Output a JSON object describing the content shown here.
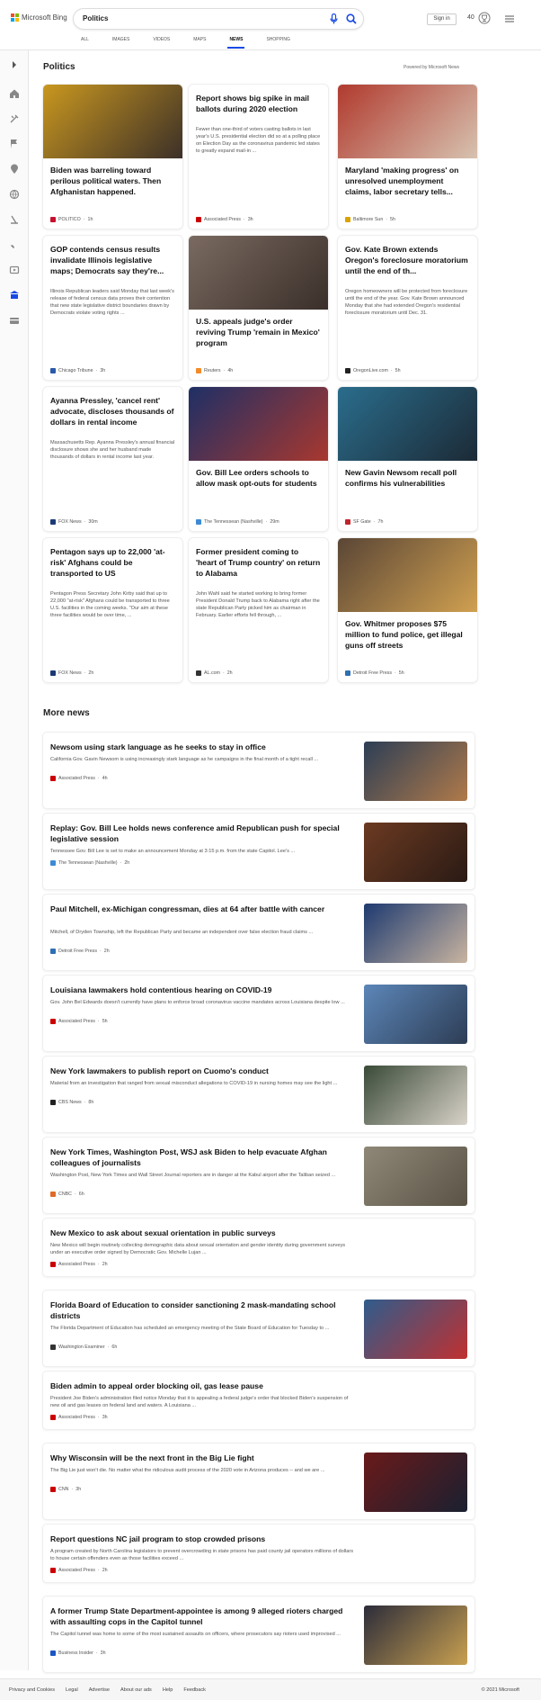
{
  "brand": {
    "logo_text": "Microsoft Bing"
  },
  "search": {
    "query": "Politics"
  },
  "header": {
    "signin_label": "Sign in",
    "rewards_points": "40"
  },
  "tabs": [
    {
      "label": "ALL"
    },
    {
      "label": "IMAGES"
    },
    {
      "label": "VIDEOS"
    },
    {
      "label": "MAPS"
    },
    {
      "label": "NEWS"
    },
    {
      "label": "SHOPPING"
    }
  ],
  "top": {
    "heading": "Politics",
    "powered": "Powered by Microsoft News"
  },
  "cards": [
    {
      "title": "Biden was barreling toward perilous political waters. Then Afghanistan happened.",
      "desc": "",
      "source": "POLITICO",
      "age": "1h",
      "src_color": "#c8102e",
      "img_colors": [
        "#c9971f",
        "#3c3028"
      ]
    },
    {
      "title": "Report shows big spike in mail ballots during 2020 election",
      "desc": "Fewer than one-third of voters casting ballots in last year's U.S. presidential election did so at a polling place on Election Day as the coronavirus pandemic led states to greatly expand mail-in ...",
      "source": "Associated Press",
      "age": "3h",
      "src_color": "#c00",
      "img_colors": []
    },
    {
      "title": "Maryland 'making progress' on unresolved unemployment claims, labor secretary tells...",
      "desc": "",
      "source": "Baltimore Sun",
      "age": "5h",
      "src_color": "#d8a400",
      "img_colors": [
        "#b03a2e",
        "#d7c2b0"
      ]
    },
    {
      "title": "GOP contends census results invalidate Illinois legislative maps; Democrats say they're...",
      "desc": "Illinois Republican leaders said Monday that last week's release of federal census data proves their contention that new state legislative district boundaries drawn by Democrats violate voting rights ...",
      "source": "Chicago Tribune",
      "age": "3h",
      "src_color": "#2a5aa8",
      "img_colors": []
    },
    {
      "title": "U.S. appeals judge's order reviving Trump 'remain in Mexico' program",
      "desc": "",
      "source": "Reuters",
      "age": "4h",
      "src_color": "#f28c28",
      "img_colors": [
        "#7a6a60",
        "#3a2f2a"
      ]
    },
    {
      "title": "Gov. Kate Brown extends Oregon's foreclosure moratorium until the end of th...",
      "desc": "Oregon homeowners will be protected from foreclosure until the end of the year. Gov. Kate Brown announced Monday that she had extended Oregon's residential foreclosure moratorium until Dec. 31.",
      "source": "OregonLive.com",
      "age": "5h",
      "src_color": "#222",
      "img_colors": []
    },
    {
      "title": "Ayanna Pressley, 'cancel rent' advocate, discloses thousands of dollars in rental income",
      "desc": "Massachusetts Rep. Ayanna Pressley's annual financial disclosure shows she and her husband made thousands of dollars in rental income last year.",
      "source": "FOX News",
      "age": "30m",
      "src_color": "#1b3a75",
      "img_colors": []
    },
    {
      "title": "Gov. Bill Lee orders schools to allow mask opt-outs for students",
      "desc": "",
      "source": "The Tennessean (Nashville)",
      "age": "29m",
      "src_color": "#3d8bd4",
      "img_colors": [
        "#1e2f66",
        "#a8382f"
      ]
    },
    {
      "title": "New Gavin Newsom recall poll confirms his vulnerabilities",
      "desc": "",
      "source": "SF Gate",
      "age": "7h",
      "src_color": "#c0262c",
      "img_colors": [
        "#2a6d8c",
        "#1c2a36"
      ]
    },
    {
      "title": "Pentagon says up to 22,000 'at-risk' Afghans could be transported to US",
      "desc": "Pentagon Press Secretary John Kirby said that up to 22,000 \"at-risk\" Afghans could be transported to three U.S. facilities in the coming weeks. \"Our aim at these three facilities would be over time, ...",
      "source": "FOX News",
      "age": "2h",
      "src_color": "#1b3a75",
      "img_colors": []
    },
    {
      "title": "Former president coming to 'heart of Trump country' on return to Alabama",
      "desc": "John Wahl said he started working to bring former President Donald Trump back to Alabama right after the state Republican Party picked him as chairman in February. Earlier efforts fell through, ...",
      "source": "AL.com",
      "age": "2h",
      "src_color": "#333",
      "img_colors": []
    },
    {
      "title": "Gov. Whitmer proposes $75 million to fund police, get illegal guns off streets",
      "desc": "",
      "source": "Detroit Free Press",
      "age": "5h",
      "src_color": "#2f6fb2",
      "img_colors": [
        "#5a4636",
        "#d0a050"
      ]
    }
  ],
  "more": {
    "heading": "More news"
  },
  "news": [
    {
      "title": "Newsom using stark language as he seeks to stay in office",
      "desc": "California Gov. Gavin Newsom is using increasingly stark language as he campaigns in the final month of a tight recall ...",
      "source": "Associated Press",
      "age": "4h",
      "src_color": "#c00",
      "img_colors": [
        "#2c3e55",
        "#b07a4a"
      ]
    },
    {
      "title": "Replay: Gov. Bill Lee holds news conference amid Republican push for special legislative session",
      "desc": "Tennessee Gov. Bill Lee is set to make an announcement Monday at 3:15 p.m. from the state Capitol. Lee's ...",
      "source": "The Tennessean (Nashville)",
      "age": "2h",
      "src_color": "#3d8bd4",
      "img_colors": [
        "#6b3a22",
        "#2a1a14"
      ]
    },
    {
      "title": "Paul Mitchell, ex-Michigan congressman, dies at 64 after battle with cancer",
      "desc": "Mitchell, of Dryden Township, left the Republican Party and became an independent over false election fraud claims ...",
      "source": "Detroit Free Press",
      "age": "2h",
      "src_color": "#2f6fb2",
      "img_colors": [
        "#1e3a70",
        "#c8b4a0"
      ]
    },
    {
      "title": "Louisiana lawmakers hold contentious hearing on COVID-19",
      "desc": "Gov. John Bel Edwards doesn't currently have plans to enforce broad coronavirus vaccine mandates across Louisiana despite low ...",
      "source": "Associated Press",
      "age": "5h",
      "src_color": "#c00",
      "img_colors": [
        "#5c86b8",
        "#2d3d55"
      ]
    },
    {
      "title": "New York lawmakers to publish report on Cuomo's conduct",
      "desc": "Material from an investigation that ranged from sexual misconduct allegations to COVID-19 in nursing homes may see the light ...",
      "source": "CBS News",
      "age": "8h",
      "src_color": "#222",
      "img_colors": [
        "#3a4a38",
        "#d8d2c8"
      ]
    },
    {
      "title": "New York Times, Washington Post, WSJ ask Biden to help evacuate Afghan colleagues of journalists",
      "desc": "Washington Post, New York Times and Wall Street Journal reporters are in danger at the Kabul airport after the Taliban seized ...",
      "source": "CNBC",
      "age": "6h",
      "src_color": "#e06a2a",
      "img_colors": [
        "#8f8878",
        "#5a5346"
      ]
    },
    {
      "title": "New Mexico to ask about sexual orientation in public surveys",
      "desc": "New Mexico will begin routinely collecting demographic data about sexual orientation and gender identity during government surveys under an executive order signed by Democratic Gov. Michelle Lujan ...",
      "source": "Associated Press",
      "age": "2h",
      "src_color": "#c00",
      "img_colors": []
    },
    {
      "title": "Florida Board of Education to consider sanctioning 2 mask-mandating school districts",
      "desc": "The Florida Department of Education has scheduled an emergency meeting of the State Board of Education for Tuesday to ...",
      "source": "Washington Examiner",
      "age": "6h",
      "src_color": "#333",
      "img_colors": [
        "#2f5c8c",
        "#c03030"
      ]
    },
    {
      "title": "Biden admin to appeal order blocking oil, gas lease pause",
      "desc": "President Joe Biden's administration filed notice Monday that it is appealing a federal judge's order that blocked Biden's suspension of new oil and gas leases on federal land and waters. A Louisiana ...",
      "source": "Associated Press",
      "age": "3h",
      "src_color": "#c00",
      "img_colors": []
    },
    {
      "title": "Why Wisconsin will be the next front in the Big Lie fight",
      "desc": "The Big Lie just won't die. No matter what the ridiculous audit process of the 2020 vote in Arizona produces -- and we are ...",
      "source": "CNN",
      "age": "3h",
      "src_color": "#cc0000",
      "img_colors": [
        "#6a1a1a",
        "#1a2030"
      ]
    },
    {
      "title": "Report questions NC jail program to stop crowded prisons",
      "desc": "A program created by North Carolina legislators to prevent overcrowding in state prisons has paid county jail operators millions of dollars to house certain offenders even as those facilities exceed ...",
      "source": "Associated Press",
      "age": "2h",
      "src_color": "#c00",
      "img_colors": []
    },
    {
      "title": "A former Trump State Department-appointee is among 9 alleged rioters charged with assaulting cops in the Capitol tunnel",
      "desc": "The Capitol tunnel was home to some of the most sustained assaults on officers, where prosecutors say rioters used improvised ...",
      "source": "Business Insider",
      "age": "3h",
      "src_color": "#1a56c4",
      "img_colors": [
        "#2c2c3a",
        "#c8a050"
      ]
    }
  ],
  "footer": {
    "links": [
      "Privacy and Cookies",
      "Legal",
      "Advertise",
      "About our ads",
      "Help",
      "Feedback"
    ],
    "copyright": "© 2021 Microsoft"
  }
}
